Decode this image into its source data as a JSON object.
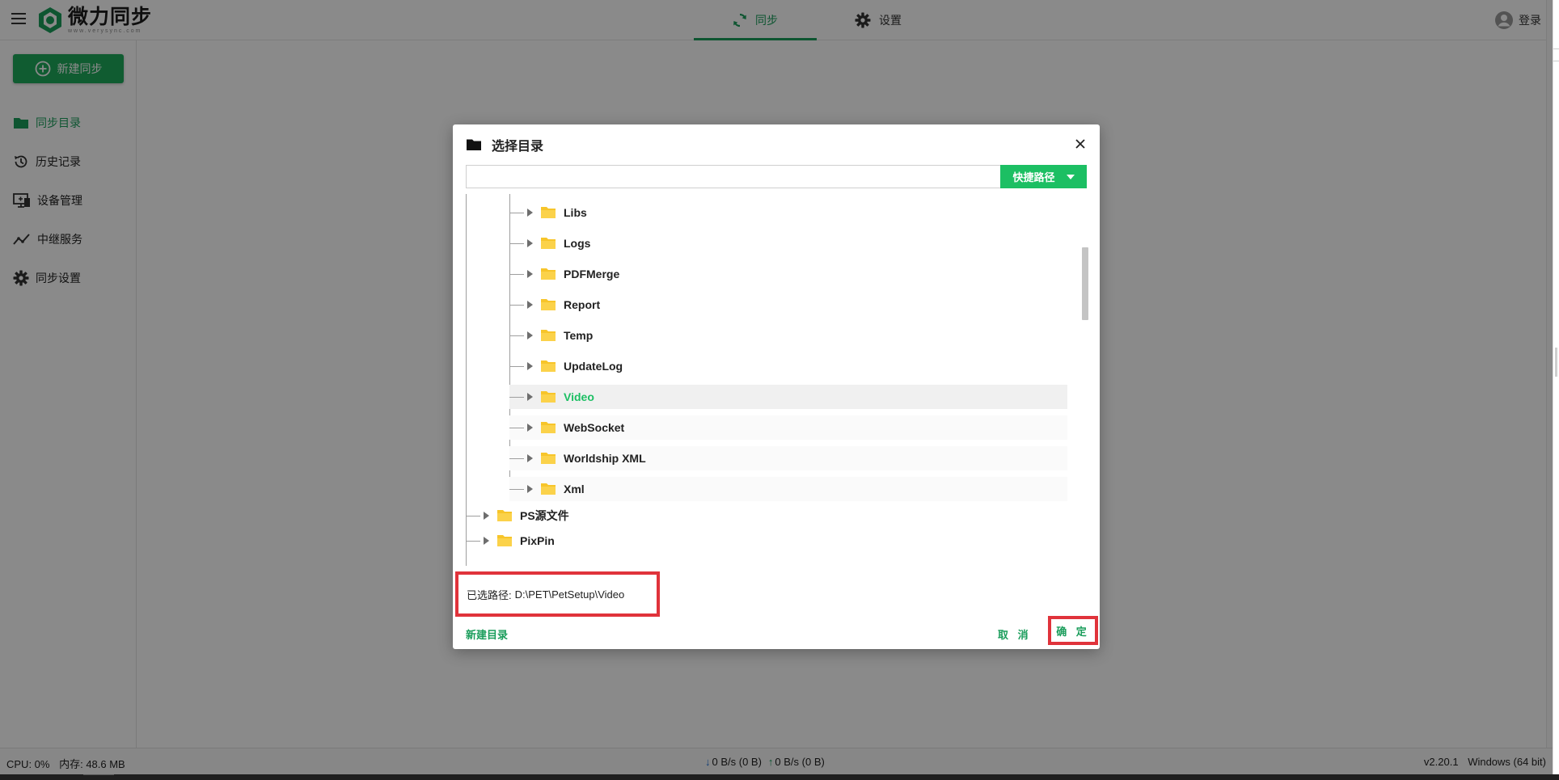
{
  "app": {
    "logo_title": "微力同步",
    "logo_sub": "www.verysync.com",
    "brand_color": "#1a9d5b"
  },
  "top_tabs": [
    {
      "label": "同步",
      "icon": "sync-icon",
      "active": true
    },
    {
      "label": "设置",
      "icon": "gear-icon",
      "active": false
    }
  ],
  "header": {
    "login_label": "登录"
  },
  "sidebar": {
    "new_sync_label": "新建同步",
    "items": [
      {
        "label": "同步目录",
        "icon": "folder-icon",
        "active": true
      },
      {
        "label": "历史记录",
        "icon": "history-icon",
        "active": false
      },
      {
        "label": "设备管理",
        "icon": "devices-icon",
        "active": false
      },
      {
        "label": "中继服务",
        "icon": "relay-icon",
        "active": false
      },
      {
        "label": "同步设置",
        "icon": "gear-icon",
        "active": false
      }
    ]
  },
  "dialog": {
    "title": "选择目录",
    "path_input_value": "",
    "quick_path_label": "快捷路径",
    "tree": {
      "children": [
        "Libs",
        "Logs",
        "PDFMerge",
        "Report",
        "Temp",
        "UpdateLog",
        "Video",
        "WebSocket",
        "Worldship XML",
        "Xml"
      ],
      "selected": "Video",
      "siblings": [
        "PS源文件",
        "PixPin"
      ]
    },
    "selected_path_label": "已选路径:",
    "selected_path_value": "D:\\PET\\PetSetup\\Video",
    "new_dir_label": "新建目录",
    "cancel_label": "取 消",
    "ok_label": "确 定",
    "highlight_color": "#e0333b"
  },
  "status_bar": {
    "cpu": "CPU: 0%",
    "memory": "内存: 48.6 MB",
    "download": "0 B/s (0 B)",
    "upload": "0 B/s (0 B)",
    "version": "v2.20.1",
    "os": "Windows (64 bit)"
  }
}
